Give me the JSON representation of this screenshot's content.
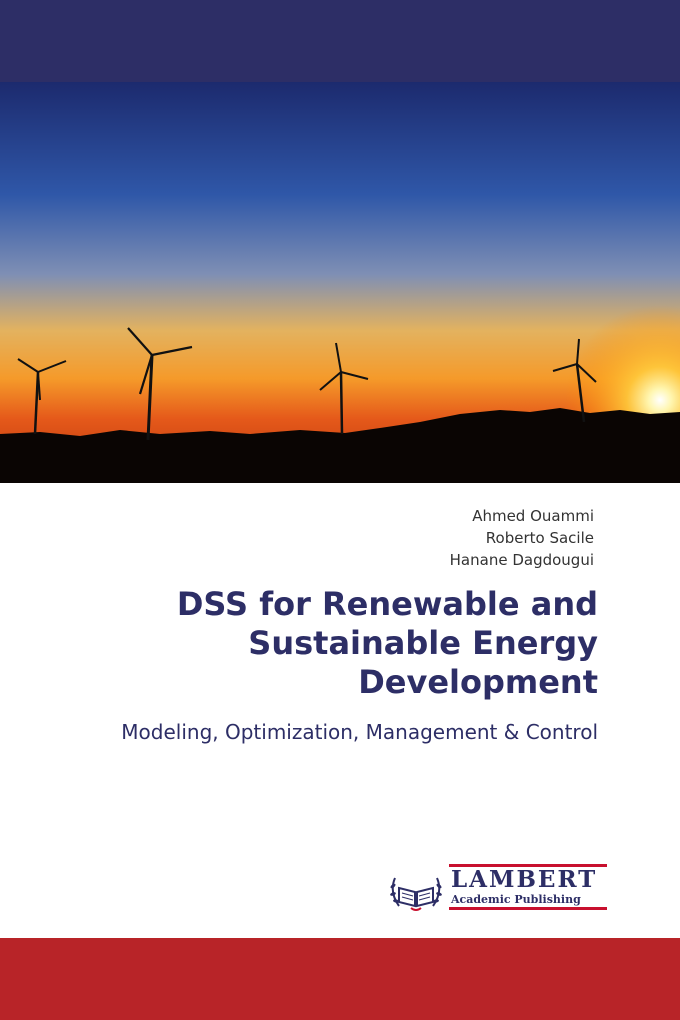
{
  "cover": {
    "authors": [
      "Ahmed Ouammi",
      "Roberto Sacile",
      "Hanane Dagdougui"
    ],
    "title": "DSS for Renewable and Sustainable Energy Development",
    "subtitle": "Modeling, Optimization, Management & Control",
    "publisher": {
      "emblem_text": "LAP",
      "name": "LAMBERT",
      "tagline": "Academic Publishing"
    },
    "photo_subject": "wind turbines silhouetted at sunset"
  },
  "colors": {
    "top_band": "#2d2e66",
    "bottom_band": "#b82428",
    "title": "#2d2e66",
    "logo_accent": "#c8102e"
  }
}
